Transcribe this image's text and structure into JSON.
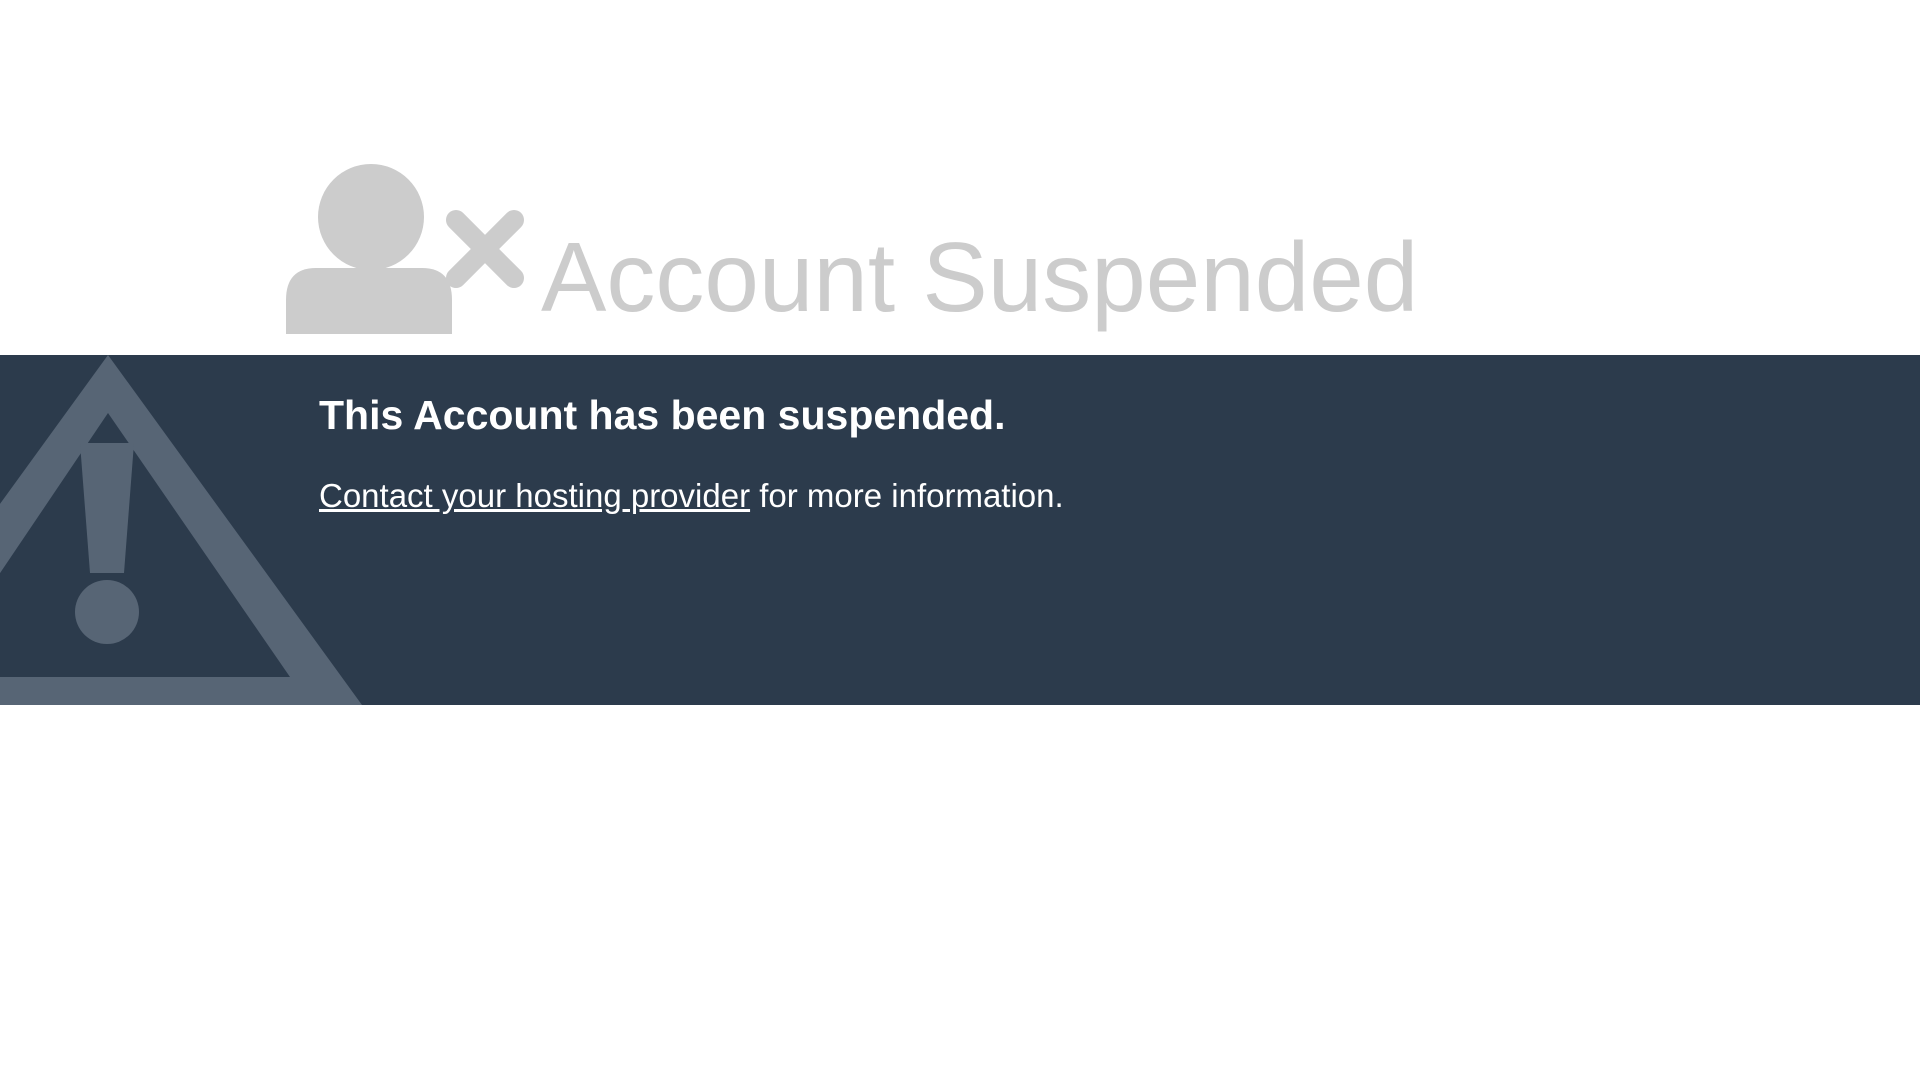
{
  "header": {
    "icon": "user-remove-icon",
    "title": "Account Suspended",
    "icon_color": "#cccccc",
    "title_color": "#cccccc"
  },
  "banner": {
    "background_color": "#2c3b4c",
    "icon": "warning-icon",
    "icon_color": "#576575",
    "heading": "This Account has been suspended.",
    "contact_link": "Contact your hosting provider",
    "message_suffix": " for more information.",
    "text_color": "#ffffff"
  }
}
